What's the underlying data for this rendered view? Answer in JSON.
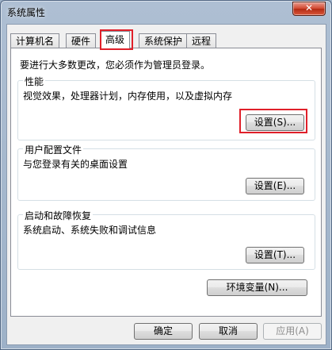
{
  "window": {
    "title": "系统属性",
    "close_glyph": "✕"
  },
  "tabs": [
    {
      "label": "计算机名",
      "active": false
    },
    {
      "label": "硬件",
      "active": false
    },
    {
      "label": "高级",
      "active": true
    },
    {
      "label": "系统保护",
      "active": false
    },
    {
      "label": "远程",
      "active": false
    }
  ],
  "intro": "要进行大多数更改，您必须作为管理员登录。",
  "performance": {
    "title": "性能",
    "description": "视觉效果，处理器计划，内存使用，以及虚拟内存",
    "button": "设置(S)..."
  },
  "user_profiles": {
    "title": "用户配置文件",
    "description": "与您登录有关的桌面设置",
    "button": "设置(E)..."
  },
  "startup_recovery": {
    "title": "启动和故障恢复",
    "description": "系统启动、系统失败和调试信息",
    "button": "设置(T)..."
  },
  "env_button": "环境变量(N)...",
  "footer": {
    "ok": "确定",
    "cancel": "取消",
    "apply": "应用(A)"
  },
  "colors": {
    "highlight": "#e0202a",
    "close_button": "#c9462c"
  }
}
